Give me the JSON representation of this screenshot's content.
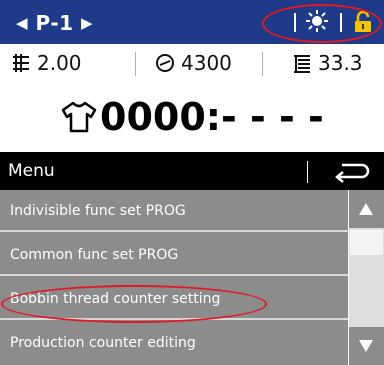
{
  "header": {
    "program_prev_icon": "triangle-left",
    "program_label": "P-1",
    "program_next_icon": "triangle-right",
    "light_icon": "sun-icon",
    "lock_icon": "padlock-icon",
    "background_color": "#1f3a88"
  },
  "stats": {
    "pitch_value": "2.00",
    "speed_value": "4300",
    "tension_value": "33.3"
  },
  "counter": {
    "icon": "shirt-icon",
    "value": "0000:- - - -"
  },
  "menu": {
    "title": "Menu",
    "back_icon": "return-arrow-icon",
    "items": [
      {
        "label": "Indivisible func set PROG"
      },
      {
        "label": "Common func set PROG"
      },
      {
        "label": "Bobbin thread counter setting"
      },
      {
        "label": "Production counter editing"
      }
    ],
    "item_color": "#8c8c8c",
    "highlight_color": "#e01b24"
  },
  "scrollbar": {
    "up_icon": "triangle-up",
    "down_icon": "triangle-down"
  }
}
